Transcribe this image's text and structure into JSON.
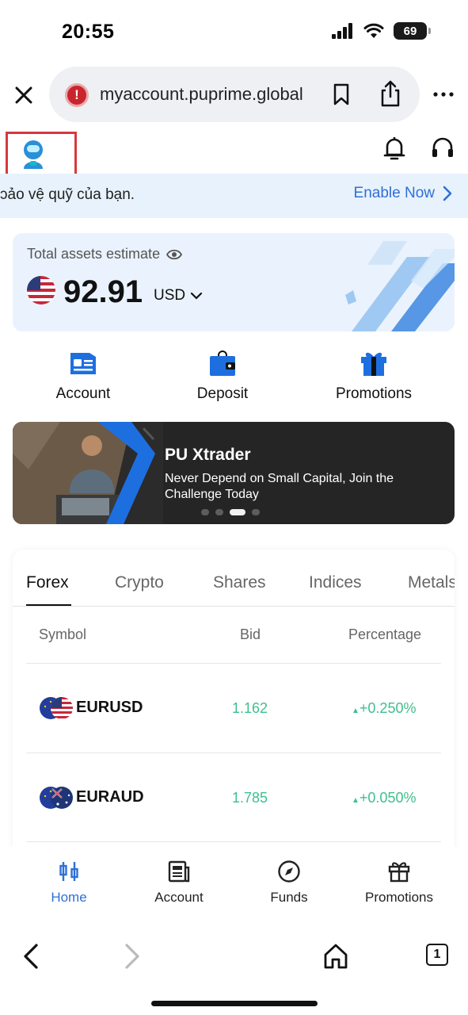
{
  "status_bar": {
    "time": "20:55",
    "battery": "69"
  },
  "browser": {
    "url": "myaccount.puprime.global",
    "tab_count": "1"
  },
  "banner": {
    "text": "ɔảo vệ quỹ của bạn.",
    "action": "Enable Now"
  },
  "assets": {
    "label": "Total assets estimate",
    "value": "92.91",
    "currency": "USD"
  },
  "quick_actions": [
    {
      "label": "Account",
      "icon": "account-card-icon"
    },
    {
      "label": "Deposit",
      "icon": "wallet-icon"
    },
    {
      "label": "Promotions",
      "icon": "gift-icon"
    }
  ],
  "promo": {
    "title": "PU Xtrader",
    "subtitle": "Never Depend on Small Capital, Join the Challenge Today",
    "slides": 4,
    "active_slide": 3
  },
  "market": {
    "tabs": [
      "Forex",
      "Crypto",
      "Shares",
      "Indices",
      "Metals"
    ],
    "active_tab": "Forex",
    "columns": {
      "symbol": "Symbol",
      "bid": "Bid",
      "percentage": "Percentage"
    },
    "rows": [
      {
        "symbol": "EURUSD",
        "bid": "1.162",
        "percentage": "+0.250%",
        "direction": "up"
      },
      {
        "symbol": "EURAUD",
        "bid": "1.785",
        "percentage": "+0.050%",
        "direction": "up"
      }
    ]
  },
  "bottom_nav": [
    {
      "label": "Home",
      "icon": "home-candles-icon",
      "active": true
    },
    {
      "label": "Account",
      "icon": "account-doc-icon",
      "active": false
    },
    {
      "label": "Funds",
      "icon": "compass-icon",
      "active": false
    },
    {
      "label": "Promotions",
      "icon": "gift-icon",
      "active": false
    }
  ],
  "colors": {
    "accent": "#2f6fd6",
    "positive": "#3fbf8f",
    "highlight_box": "#d8383f",
    "banner_bg": "#e8f2fc",
    "promo_bg": "#252525"
  }
}
